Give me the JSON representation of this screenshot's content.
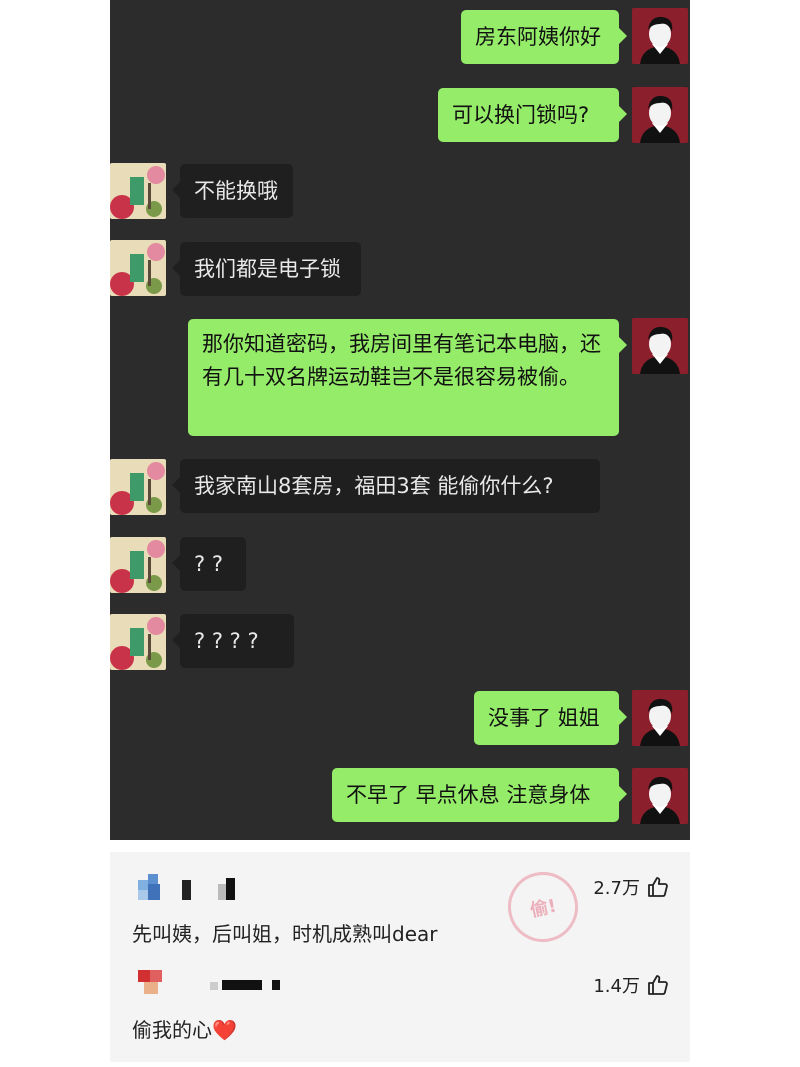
{
  "chat": {
    "messages": [
      {
        "side": "right",
        "text": "房东阿姨你好"
      },
      {
        "side": "right",
        "text": "可以换门锁吗?"
      },
      {
        "side": "left",
        "text": "不能换哦"
      },
      {
        "side": "left",
        "text": "我们都是电子锁"
      },
      {
        "side": "right",
        "text": "那你知道密码，我房间里有笔记本电脑，还有几十双名牌运动鞋岂不是很容易被偷。"
      },
      {
        "side": "left",
        "text": "我家南山8套房，福田3套 能偷你什么?"
      },
      {
        "side": "left",
        "text": "? ?"
      },
      {
        "side": "left",
        "text": "? ? ? ?"
      },
      {
        "side": "right",
        "text": "没事了 姐姐"
      },
      {
        "side": "right",
        "text": "不早了 早点休息 注意身体"
      }
    ]
  },
  "comments": [
    {
      "likes": "2.7万",
      "text": "先叫姨，后叫姐，时机成熟叫dear"
    },
    {
      "likes": "1.4万",
      "text": "偷我的心",
      "emoji": "❤️"
    }
  ],
  "icons": {
    "like": "thumb-up-icon"
  },
  "colors": {
    "chat_bg": "#2c2c2c",
    "sent_bubble": "#95ec69",
    "received_bubble": "#1f1f1f"
  }
}
